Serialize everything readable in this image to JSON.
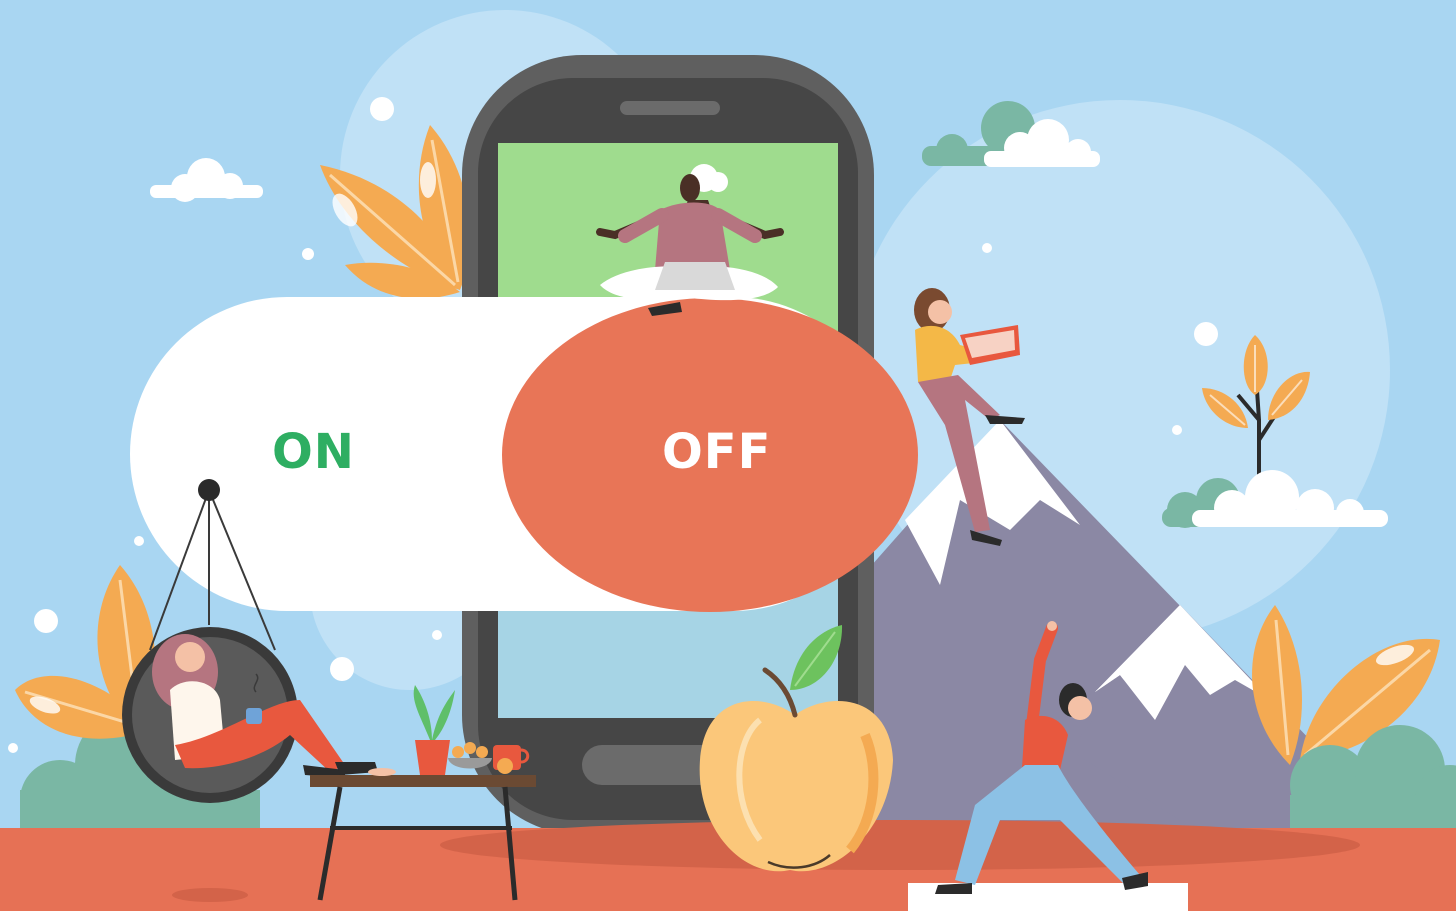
{
  "toggle": {
    "on_label": "ON",
    "off_label": "OFF",
    "state": "off"
  },
  "colors": {
    "sky": "#a9d6f2",
    "ground": "#e67155",
    "toggle_track": "#ffffff",
    "toggle_knob": "#e87557",
    "on_text": "#2eae62",
    "off_text": "#ffffff",
    "phone_body": "#4a4a4a",
    "mountain": "#8b88a4",
    "leaf_orange": "#f4aa52",
    "bush_green": "#7ab7a4"
  }
}
